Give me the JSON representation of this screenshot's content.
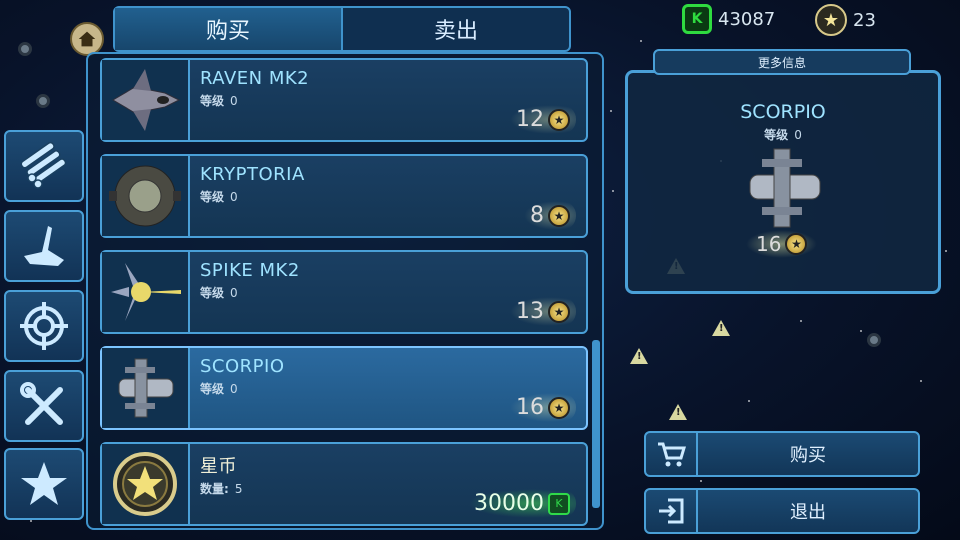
{
  "currency": {
    "gems": "43087",
    "stars": "23"
  },
  "tabs": [
    {
      "label": "购买",
      "active": true
    },
    {
      "label": "卖出",
      "active": false
    }
  ],
  "side_categories": [
    {
      "icon": "missiles-icon"
    },
    {
      "icon": "wing-icon"
    },
    {
      "icon": "crosshair-icon"
    },
    {
      "icon": "tools-icon"
    },
    {
      "icon": "star-icon"
    }
  ],
  "items": [
    {
      "name": "RAVEN MK2",
      "level_label": "等级",
      "level": "0",
      "price": "12",
      "currency": "star"
    },
    {
      "name": "KRYPTORIA",
      "level_label": "等级",
      "level": "0",
      "price": "8",
      "currency": "star"
    },
    {
      "name": "SPIKE MK2",
      "level_label": "等级",
      "level": "0",
      "price": "13",
      "currency": "star"
    },
    {
      "name": "SCORPIO",
      "level_label": "等级",
      "level": "0",
      "price": "16",
      "currency": "star",
      "selected": true
    },
    {
      "name": "星币",
      "level_label": "数量:",
      "level": "5",
      "price": "30000",
      "currency": "gem"
    }
  ],
  "info": {
    "more_label": "更多信息",
    "name": "SCORPIO",
    "level_label": "等级",
    "level": "0",
    "price": "16"
  },
  "actions": {
    "buy_label": "购买",
    "exit_label": "退出"
  },
  "colors": {
    "accent": "#4aa0d8",
    "gem": "#2fdb40",
    "name_text": "#9fe3ff"
  }
}
